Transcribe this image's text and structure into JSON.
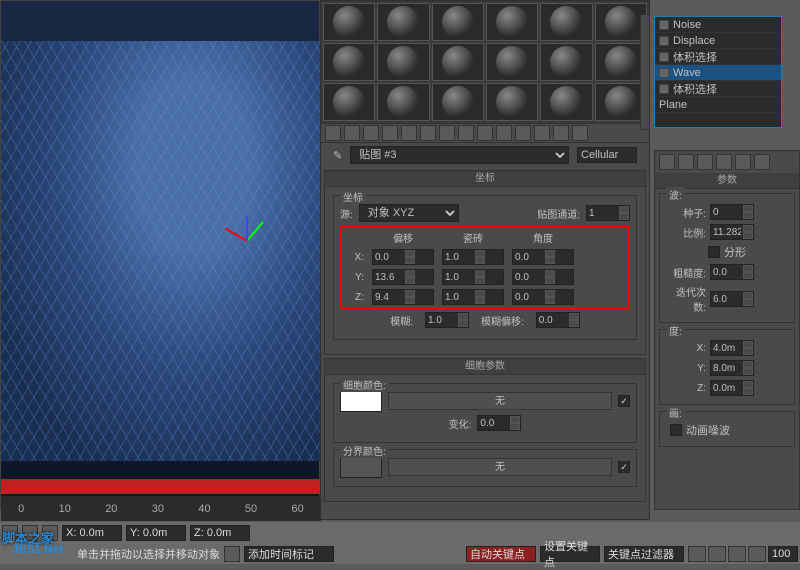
{
  "viewport": {
    "gizmo_colors": [
      "#ff0000",
      "#00ff00",
      "#4444ff"
    ]
  },
  "timeline": {
    "ticks": [
      "0",
      "10",
      "20",
      "30",
      "40",
      "50",
      "60"
    ]
  },
  "status": {
    "x": "X: 0.0m",
    "y": "Y: 0.0m",
    "z": "Z: 0.0m",
    "hint": "单击并拖动以选择并移动对象",
    "add_time": "添加时间标记",
    "auto_key": "自动关键点",
    "set_key": "设置关键点",
    "key_filter": "关键点过滤器",
    "frame": "100"
  },
  "material": {
    "map_name": "贴图 #3",
    "map_type": "Cellular",
    "coords": {
      "title": "坐标",
      "group": "坐标",
      "source_label": "源:",
      "source": "对象 XYZ",
      "mapchan_label": "贴图通道:",
      "mapchan": "1",
      "offset": "偏移",
      "tiling": "瓷砖",
      "angle": "角度",
      "x": "X:",
      "y": "Y:",
      "z": "Z:",
      "xo": "0.0",
      "xt": "1.0",
      "xa": "0.0",
      "yo": "13.6",
      "yt": "1.0",
      "ya": "0.0",
      "zo": "9.4",
      "zt": "1.0",
      "za": "0.0",
      "blur_label": "模糊:",
      "blur": "1.0",
      "bluroff_label": "模糊偏移:",
      "bluroff": "0.0"
    },
    "cell": {
      "title": "细胞参数",
      "cellcolor": "细胞颜色:",
      "none": "无",
      "variation_label": "变化:",
      "variation": "0.0",
      "divcolor": "分界颜色:"
    }
  },
  "stack": {
    "items": [
      "Noise",
      "Displace",
      "体积选择",
      "Wave",
      "体积选择"
    ],
    "selected": 3,
    "base": "Plane"
  },
  "panel2": {
    "title": "参数",
    "group_wave": "波:",
    "seed_label": "种子:",
    "seed": "0",
    "scale_label": "比例:",
    "scale": "11.282",
    "fractal": "分形",
    "rough_label": "粗糙度:",
    "rough": "0.0",
    "iter_label": "迭代次数:",
    "iter": "6.0",
    "strength": "度:",
    "x_label": "X:",
    "x": "4.0m",
    "y_label": "Y:",
    "y": "8.0m",
    "z_label": "Z:",
    "z": "0.0m",
    "anim": "画:",
    "anim_noise": "动画噪波"
  },
  "watermark": {
    "l1": "脚本之家",
    "l2": "JB51.Net"
  }
}
